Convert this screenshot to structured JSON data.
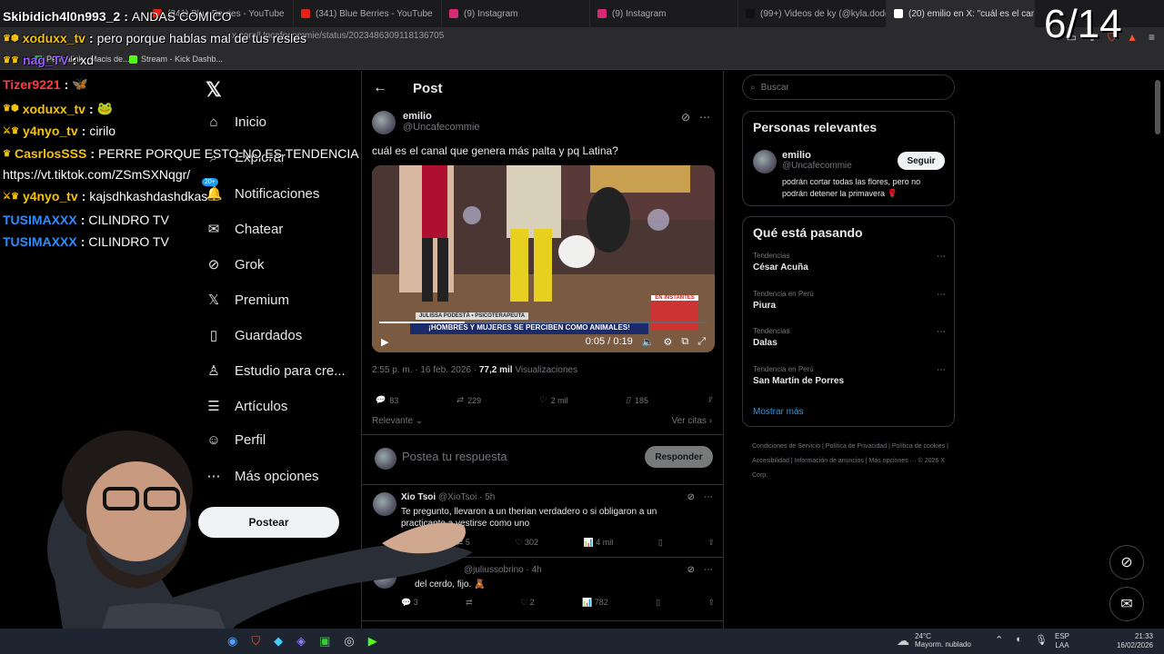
{
  "browser": {
    "tabs": [
      {
        "label": "(341) Blue Berries - YouTube",
        "color": "#e62117"
      },
      {
        "label": "(341) Blue Berries - YouTube",
        "color": "#e62117"
      },
      {
        "label": "(9) Instagram",
        "color": "#d62976"
      },
      {
        "label": "(9) Instagram",
        "color": "#d62976"
      },
      {
        "label": "(99+) Videos de ky (@kyla.dodds) co",
        "color": "#111111"
      },
      {
        "label": "(20) emilio en X: \"cuál es el canal",
        "color": "#ffffff"
      }
    ],
    "active_tab_close": "✕",
    "url": "x.com/Uncafecommie/status/2023486309118136705",
    "bookmarks": [
      {
        "label": "Permalink - Macis de...",
        "color": "#2aa34a"
      },
      {
        "label": "Stream - Kick Dashb...",
        "color": "#53fc18"
      }
    ]
  },
  "overlay": {
    "counter": "6/14",
    "chat": [
      {
        "user": "Skibidich4l0n993_2",
        "color": "#ffffff",
        "text": "ANDAS COMICO",
        "crowns": ""
      },
      {
        "user": "xoduxx_tv",
        "color": "#f4c20d",
        "text": "pero porque hablas mal de tus resles",
        "crowns": "♛⬢"
      },
      {
        "user": "nag_TV",
        "color": "#9b59ff",
        "text": "xd",
        "crowns": "♛♛"
      },
      {
        "user": "Tizer9221",
        "color": "#ff3b3b",
        "text": "🦋",
        "crowns": ""
      },
      {
        "user": "xoduxx_tv",
        "color": "#f4c20d",
        "text": "🐸",
        "crowns": "♛⬢"
      },
      {
        "user": "y4nyo_tv",
        "color": "#f4c20d",
        "text": "cirilo",
        "crowns": "⚔♛"
      },
      {
        "user": "CasrlosSSS",
        "color": "#f4c20d",
        "text": "PERRE PORQUE ESTO NO ES TENDENCIA",
        "crowns": "♛"
      },
      {
        "user": "",
        "color": "#ffffff",
        "text": "https://vt.tiktok.com/ZSmSXNqgr/",
        "crowns": ""
      },
      {
        "user": "y4nyo_tv",
        "color": "#f4c20d",
        "text": "kajsdhkashdashdkas",
        "crowns": "⚔♛"
      },
      {
        "user": "TUSIMAXXX",
        "color": "#2f8cff",
        "text": "CILINDRO TV",
        "crowns": ""
      },
      {
        "user": "TUSIMAXXX",
        "color": "#2f8cff",
        "text": "CILINDRO TV",
        "crowns": ""
      }
    ]
  },
  "nav": {
    "logo": "𝕏",
    "items": [
      {
        "label": "Inicio",
        "icon": "⌂"
      },
      {
        "label": "Explorar",
        "icon": "⌕"
      },
      {
        "label": "Notificaciones",
        "icon": "🔔"
      },
      {
        "label": "Chatear",
        "icon": "✉"
      },
      {
        "label": "Grok",
        "icon": "⊘"
      },
      {
        "label": "Premium",
        "icon": "𝕏"
      },
      {
        "label": "Guardados",
        "icon": "▯"
      },
      {
        "label": "Estudio para cre...",
        "icon": "♙"
      },
      {
        "label": "Artículos",
        "icon": "☰"
      },
      {
        "label": "Perfil",
        "icon": "☺"
      },
      {
        "label": "Más opciones",
        "icon": "⋯"
      }
    ],
    "notif_badge": "20+",
    "post_button": "Postear"
  },
  "post": {
    "header": "Post",
    "author_name": "emilio",
    "author_handle": "@Uncafecommie",
    "text": "cuál es el canal que genera más palta y pq Latina?",
    "video": {
      "banner_top": "JULISSA PODESTÁ • PSICOTERAPEUTA",
      "banner": "¡HOMBRES Y MUJERES SE PERCIBEN COMO ANIMALES!",
      "badge": "EN INSTANTES",
      "time": "0:05 / 0:19",
      "progress": 0.26
    },
    "time_date": "2:55 p. m. · 16 feb. 2026 · ",
    "views": "77,2 mil",
    "views_label": " Visualizaciones",
    "stats": {
      "replies": "83",
      "reposts": "229",
      "likes": "2 mil",
      "bookmarks": "185"
    },
    "sort": "Relevante",
    "quotes": "Ver citas ›",
    "reply_placeholder": "Postea tu respuesta",
    "reply_button": "Responder",
    "replies": [
      {
        "name": "Xio Tsoi",
        "handle": "@XioTsoi · 5h",
        "text": "Te pregunto, llevaron a un therian verdadero o si obligaron a un practicante a vestirse como uno",
        "replies": "",
        "reposts": "5",
        "likes": "302",
        "views": "4 mil"
      },
      {
        "name": "",
        "handle": "@juliussobrino · 4h",
        "text": "del cerdo, fijo. 🧸",
        "replies": "3",
        "reposts": "",
        "likes": "2",
        "views": "782"
      }
    ]
  },
  "sidebar": {
    "search_placeholder": "Buscar",
    "relevant_title": "Personas relevantes",
    "person": {
      "name": "emilio",
      "handle": "@Uncafecommie",
      "bio": "podrán cortar todas las flores, pero no podrán detener la primavera 🌹",
      "follow": "Seguir"
    },
    "trends_title": "Qué está pasando",
    "trends": [
      {
        "category": "Tendencias",
        "topic": "César Acuña"
      },
      {
        "category": "Tendencia en Perú",
        "topic": "Piura"
      },
      {
        "category": "Tendencias",
        "topic": "Dalas"
      },
      {
        "category": "Tendencia en Perú",
        "topic": "San Martín de Porres"
      }
    ],
    "show_more": "Mostrar más",
    "footer": "Condiciones de Servicio | Política de Privacidad | Política de cookies | Accesibilidad | Información de anuncios | Más opciones ··· © 2026 X Corp."
  },
  "taskbar": {
    "temp": "24°C",
    "weather": "Mayorm. nublado",
    "lang": "ESP",
    "layout": "LAA",
    "time": "21:33",
    "date": "16/02/2026"
  },
  "colors": {
    "accent": "#1d9bf0",
    "bg": "#000000",
    "border": "#2f3336",
    "muted": "#71767b"
  }
}
